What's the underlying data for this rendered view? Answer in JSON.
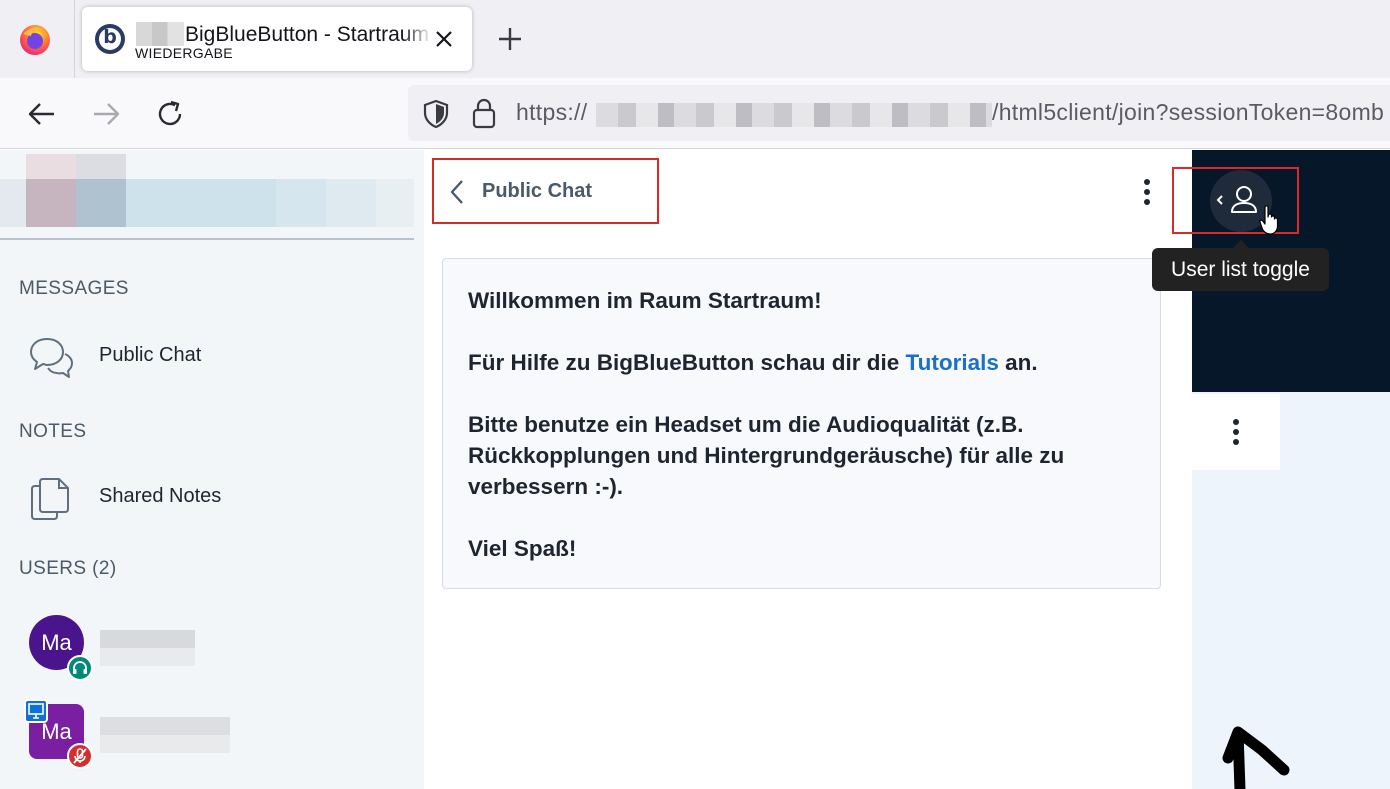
{
  "browser": {
    "tab": {
      "title": "BigBlueButton - Startraum",
      "subtitle": "WIEDERGABE"
    },
    "url": {
      "protocol": "https://",
      "path": "/html5client/join?sessionToken=8omb"
    }
  },
  "sidebar": {
    "messages_header": "MESSAGES",
    "public_chat_label": "Public Chat",
    "notes_header": "NOTES",
    "shared_notes_label": "Shared Notes",
    "users_header": "USERS (2)",
    "users": [
      {
        "initials": "Ma",
        "status": "listening"
      },
      {
        "initials": "Ma",
        "status": "muted",
        "presenter": true
      }
    ]
  },
  "chat": {
    "title": "Public Chat",
    "welcome": {
      "line1_prefix": "Willkommen im Raum ",
      "line1_room": "Startraum",
      "line1_suffix": "!",
      "line2_prefix": "Für Hilfe zu BigBlueButton schau dir die ",
      "line2_link": "Tutorials",
      "line2_suffix": " an.",
      "line3": "Bitte benutze ein Headset um die Audioqualität (z.B. Rückkopplungen und Hintergrundgeräusche) für alle zu verbessern :-).",
      "line4": "Viel Spaß!"
    }
  },
  "presentation": {
    "tooltip": "User list toggle"
  },
  "colors": {
    "accent_link": "#1b6fc9",
    "highlight_box": "#d92a2a",
    "avatar_1": "#4a148c",
    "avatar_2": "#7b1fa2",
    "badge_listen": "#00897b",
    "badge_muted": "#d32f2f",
    "presenter": "#0f70d7"
  }
}
